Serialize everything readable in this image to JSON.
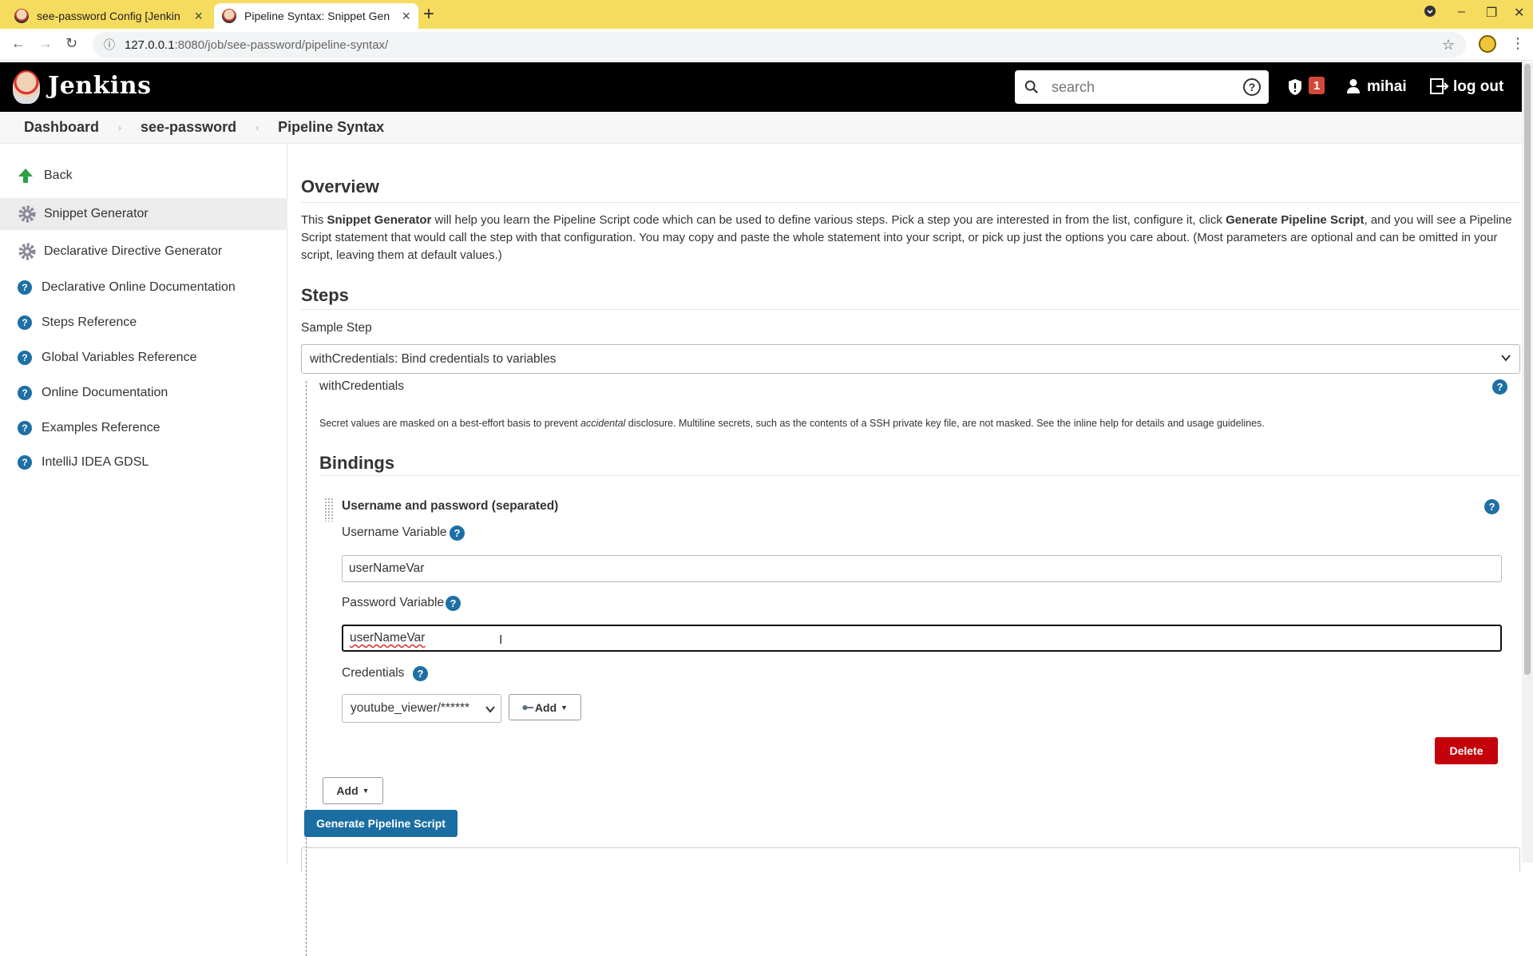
{
  "browser": {
    "tabs": [
      {
        "title": "see-password Config [Jenkin",
        "active": false
      },
      {
        "title": "Pipeline Syntax: Snippet Gen",
        "active": true
      }
    ],
    "url_host": "127.0.0.1",
    "url_path": ":8080/job/see-password/pipeline-syntax/",
    "tab_color": "#f6dc5e"
  },
  "header": {
    "app_name": "Jenkins",
    "search_placeholder": "search",
    "security_count": "1",
    "user": "mihai",
    "logout_label": "log out"
  },
  "breadcrumb": [
    "Dashboard",
    "see-password",
    "Pipeline Syntax"
  ],
  "sidebar": {
    "items": [
      {
        "label": "Back",
        "icon": "up-arrow-icon"
      },
      {
        "label": "Snippet Generator",
        "icon": "gear-icon",
        "active": true
      },
      {
        "label": "Declarative Directive Generator",
        "icon": "gear-icon"
      },
      {
        "label": "Declarative Online Documentation",
        "icon": "help-icon"
      },
      {
        "label": "Steps Reference",
        "icon": "help-icon"
      },
      {
        "label": "Global Variables Reference",
        "icon": "help-icon"
      },
      {
        "label": "Online Documentation",
        "icon": "help-icon"
      },
      {
        "label": "Examples Reference",
        "icon": "help-icon"
      },
      {
        "label": "IntelliJ IDEA GDSL",
        "icon": "help-icon"
      }
    ]
  },
  "main": {
    "overview_title": "Overview",
    "overview": {
      "p1": "This ",
      "b1": "Snippet Generator",
      "p2": " will help you learn the Pipeline Script code which can be used to define various steps. Pick a step you are interested in from the list, configure it, click ",
      "b2": "Generate Pipeline Script",
      "p3": ", and you will see a Pipeline Script statement that would call the step with that configuration. You may copy and paste the whole statement into your script, or pick up just the options you care about. (Most parameters are optional and can be omitted in your script, leaving them at default values.)"
    },
    "steps_title": "Steps",
    "sample_step_label": "Sample Step",
    "sample_step_value": "withCredentials: Bind credentials to variables",
    "step_name": "withCredentials",
    "note": {
      "p1": "Secret values are masked on a best-effort basis to prevent ",
      "em": "accidental",
      "p2": " disclosure. Multiline secrets, such as the contents of a SSH private key file, are not masked. See the inline help for details and usage guidelines."
    },
    "bindings_title": "Bindings",
    "binding": {
      "title": "Username and password (separated)",
      "username_label": "Username Variable",
      "username_value": "userNameVar",
      "password_label": "Password Variable",
      "password_value": "userNameVar",
      "credentials_label": "Credentials",
      "credentials_value": "youtube_viewer/******",
      "add_label": "Add",
      "delete_label": "Delete"
    },
    "add_label": "Add",
    "generate_label": "Generate Pipeline Script"
  }
}
